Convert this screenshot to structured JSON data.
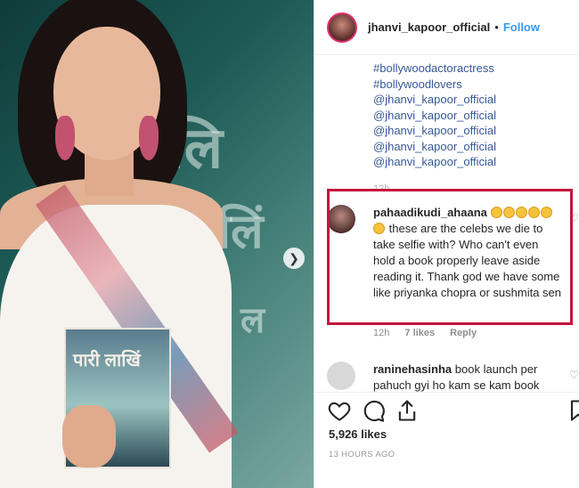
{
  "post": {
    "image_text": {
      "bg_line1": "लि",
      "bg_line2": "लिं",
      "bg_line3": "ल",
      "book_title": "पारी लाखिं"
    },
    "header": {
      "username": "jhanvi_kapoor_official",
      "separator": "•",
      "follow_label": "Follow"
    },
    "caption_tags": [
      "#bollywoodactoractress",
      "#bollywoodlovers",
      "@jhanvi_kapoor_official",
      "@jhanvi_kapoor_official",
      "@jhanvi_kapoor_official",
      "@jhanvi_kapoor_official",
      "@jhanvi_kapoor_official"
    ],
    "caption_time": "12h",
    "highlighted_comment": {
      "username": "pahaadikudi_ahaana",
      "text": "these are the celebs we die to take selfie with? Who can't even hold a book properly leave aside reading it. Thank god we have some like priyanka chopra or sushmita sen",
      "time": "12h",
      "likes": "7 likes",
      "reply": "Reply"
    },
    "second_comment": {
      "username": "raninehasinha",
      "text": "book launch per pahuch gyi ho kam se kam book"
    },
    "likes_count": "5,926 likes",
    "post_time": "13 HOURS AGO",
    "accent_color": "#3897f0",
    "highlight_color": "#c4163f"
  }
}
